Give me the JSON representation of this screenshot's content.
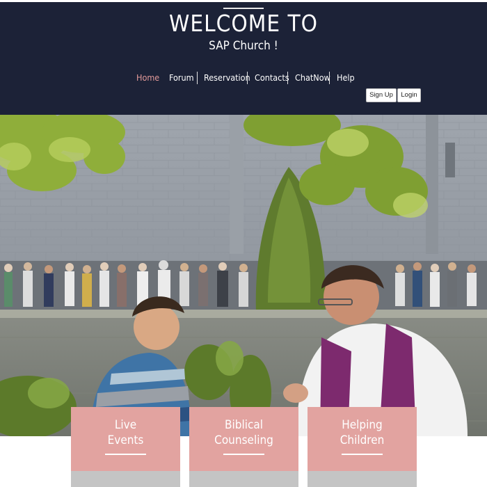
{
  "header": {
    "title": "WELCOME TO",
    "subtitle": "SAP Church !"
  },
  "nav": {
    "items": [
      {
        "label": "Home",
        "active": true
      },
      {
        "label": "Forum"
      },
      {
        "label": "Reservation"
      },
      {
        "label": "Contacts"
      },
      {
        "label": "ChatNow"
      },
      {
        "label": "Help"
      }
    ]
  },
  "auth": {
    "signup_label": "Sign Up",
    "login_label": "Login"
  },
  "cards": [
    {
      "label": "Live\nEvents"
    },
    {
      "label": "Biblical\nCounseling"
    },
    {
      "label": "Helping\nChildren"
    }
  ],
  "colors": {
    "header_bg": "#1c2237",
    "accent_active": "#e39a9a",
    "card_bg": "#e2a3a0",
    "card_footer": "#c4c4c4"
  }
}
